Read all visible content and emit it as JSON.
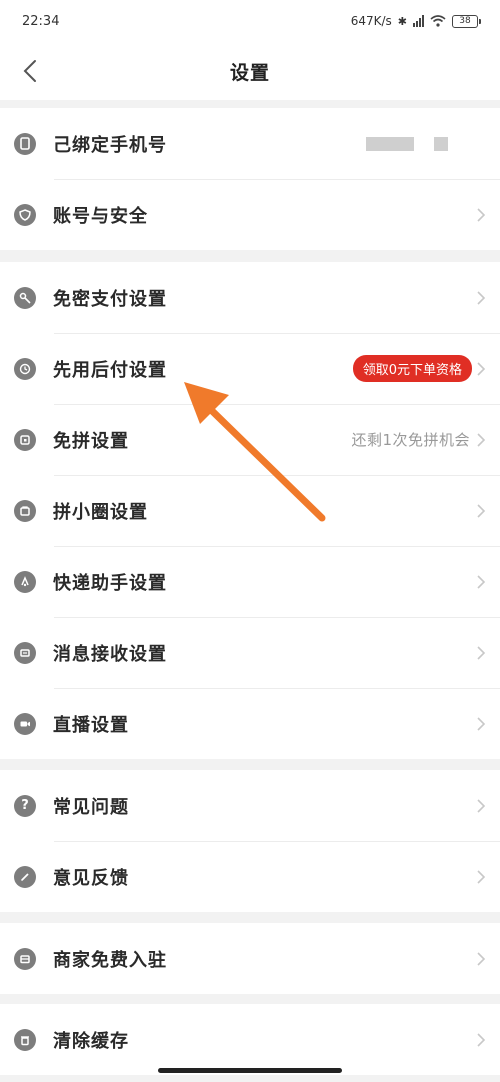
{
  "status_bar": {
    "time": "22:34",
    "net_speed": "647K/s",
    "battery": "38"
  },
  "header": {
    "title": "设置"
  },
  "groups": [
    {
      "items": [
        {
          "label": "己绑定手机号",
          "icon": "phone-icon"
        },
        {
          "label": "账号与安全",
          "icon": "shield-icon"
        }
      ]
    },
    {
      "items": [
        {
          "label": "免密支付设置",
          "icon": "key-icon"
        },
        {
          "label": "先用后付设置",
          "icon": "clock-icon",
          "badge": "领取0元下单资格"
        },
        {
          "label": "免拼设置",
          "icon": "square-icon",
          "extra": "还剩1次免拼机会"
        },
        {
          "label": "拼小圈设置",
          "icon": "bag-icon"
        },
        {
          "label": "快递助手设置",
          "icon": "delivery-icon"
        },
        {
          "label": "消息接收设置",
          "icon": "message-icon"
        },
        {
          "label": "直播设置",
          "icon": "video-icon"
        }
      ]
    },
    {
      "items": [
        {
          "label": "常见问题",
          "icon": "question-icon"
        },
        {
          "label": "意见反馈",
          "icon": "pencil-icon"
        }
      ]
    },
    {
      "items": [
        {
          "label": "商家免费入驻",
          "icon": "store-icon"
        }
      ]
    },
    {
      "items": [
        {
          "label": "清除缓存",
          "icon": "trash-icon"
        }
      ]
    }
  ],
  "colors": {
    "badge": "#e02e24",
    "arrow": "#f07a2b",
    "icon": "#7d7d7d"
  }
}
